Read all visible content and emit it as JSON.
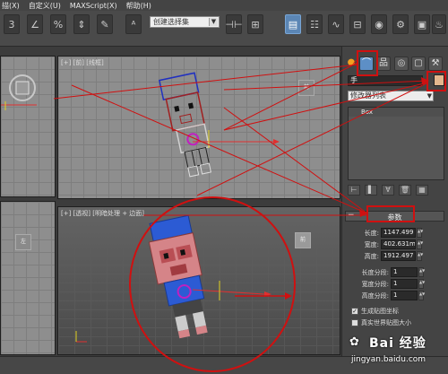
{
  "menu": {
    "items": [
      "描(X)",
      "自定义(U)",
      "MAXScript(X)",
      "帮助(H)"
    ]
  },
  "toolbar": {
    "selection_set": "创建选择集"
  },
  "viewports": {
    "top_right_label": "[+] [前] [线框]",
    "perspective_label": "[+] [透视] [明暗处理 + 边面]"
  },
  "command_panel": {
    "tabs": [
      "create-icon",
      "modify-icon",
      "hierarchy-icon",
      "motion-icon",
      "display-icon",
      "utilities-icon"
    ],
    "object_name": "手",
    "object_color": "#e3b78e",
    "modifier_list": "修改器列表",
    "stack_item": "Box",
    "rollout_title": "参数",
    "params": [
      {
        "label": "长度:",
        "value": "1147.499"
      },
      {
        "label": "宽度:",
        "value": "402.631m"
      },
      {
        "label": "高度:",
        "value": "1912.497"
      }
    ],
    "segments": [
      {
        "label": "长度分段:",
        "value": "1"
      },
      {
        "label": "宽度分段:",
        "value": "1"
      },
      {
        "label": "高度分段:",
        "value": "1"
      }
    ],
    "checks": [
      {
        "label": "生成贴图坐标",
        "checked": true
      },
      {
        "label": "真实世界贴图大小",
        "checked": false
      }
    ]
  },
  "watermark": {
    "text": "Bai 经验",
    "url": "jingyan.baidu.com"
  },
  "colors": {
    "annotation": "#d01010",
    "selection": "#c020c0",
    "axis_x": "#e03030",
    "axis_y": "#e0d020"
  }
}
